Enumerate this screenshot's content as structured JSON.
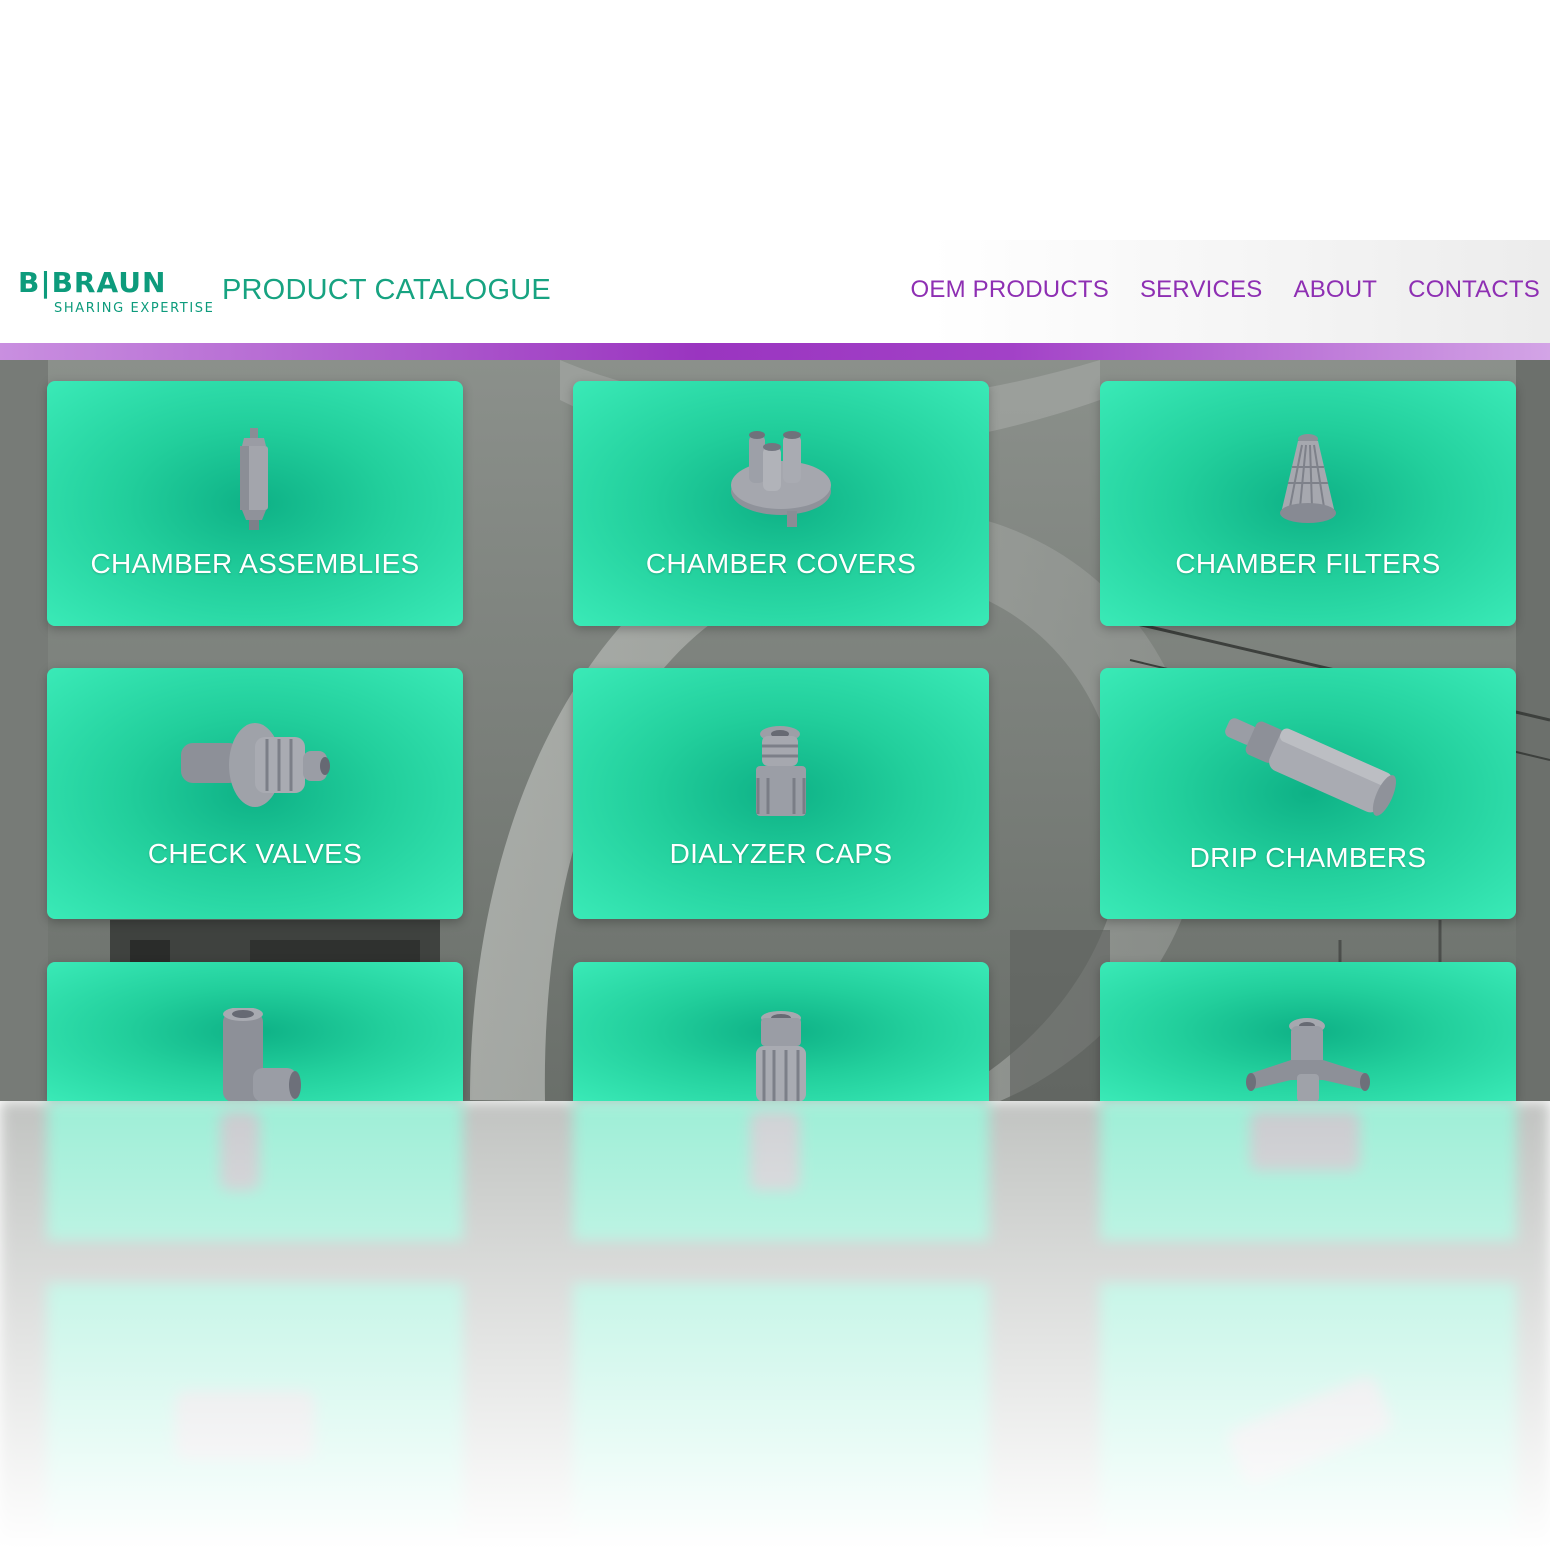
{
  "brand": {
    "wordmark": "B|BRAUN",
    "tagline": "SHARING EXPERTISE",
    "title": "PRODUCT CATALOGUE"
  },
  "nav": {
    "items": [
      {
        "label": "OEM PRODUCTS"
      },
      {
        "label": "SERVICES"
      },
      {
        "label": "ABOUT"
      },
      {
        "label": "CONTACTS"
      }
    ]
  },
  "colors": {
    "brand_green": "#0d9b7c",
    "nav_purple": "#8e2fb3",
    "tile_green": "#22cf9c",
    "accent_bar": "#a241c7"
  },
  "tiles": [
    {
      "label": "CHAMBER ASSEMBLIES",
      "icon": "chamber-assembly-icon"
    },
    {
      "label": "CHAMBER COVERS",
      "icon": "chamber-cover-icon"
    },
    {
      "label": "CHAMBER FILTERS",
      "icon": "chamber-filter-icon"
    },
    {
      "label": "CHECK VALVES",
      "icon": "check-valve-icon"
    },
    {
      "label": "DIALYZER CAPS",
      "icon": "dialyzer-cap-icon"
    },
    {
      "label": "DRIP CHAMBERS",
      "icon": "drip-chamber-icon"
    },
    {
      "label": "",
      "icon": "tee-connector-icon"
    },
    {
      "label": "",
      "icon": "luer-connector-icon"
    },
    {
      "label": "",
      "icon": "cross-connector-icon"
    }
  ]
}
